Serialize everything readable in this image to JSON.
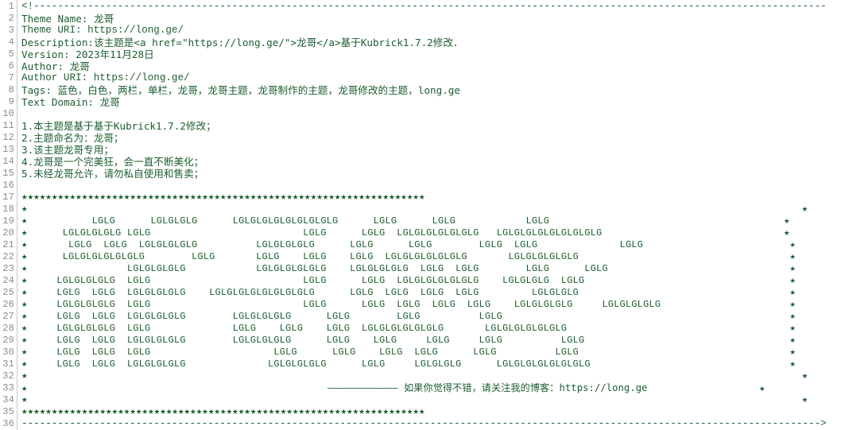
{
  "editor": {
    "language": "css-comment",
    "first_line": 1,
    "last_line": 36,
    "text_color": "#1c5e2e",
    "gutter_color": "#8c8c8c",
    "background": "#ffffff"
  },
  "gutter": {
    "line_numbers": [
      "1",
      "2",
      "3",
      "4",
      "5",
      "6",
      "7",
      "8",
      "9",
      "10",
      "11",
      "12",
      "13",
      "14",
      "15",
      "16",
      "17",
      "18",
      "19",
      "20",
      "21",
      "22",
      "23",
      "24",
      "25",
      "26",
      "27",
      "28",
      "29",
      "30",
      "31",
      "32",
      "33",
      "34",
      "35",
      "36"
    ]
  },
  "code": {
    "lines": [
      "<!------------------------------------------------------------------------------------------------------------------------------------",
      "Theme Name: 龙哥",
      "Theme URI: https://long.ge/",
      "Description:该主题是<a href=\"https://long.ge/\">龙哥</a>基于Kubrick1.7.2修改．",
      "Version: 2023年11月28日",
      "Author: 龙哥",
      "Author URI: https://long.ge/",
      "Tags: 蓝色，白色，两栏，单栏，龙哥，龙哥主题，龙哥制作的主题，龙哥修改的主题，long.ge",
      "Text Domain: 龙哥",
      "",
      "1.本主题是基于基于Kubrick1.7.2修改；",
      "2.主题命名为：龙哥；",
      "3.该主题龙哥专用；",
      "4.龙哥是一个完美狂，会一直不断美化；",
      "5.未经龙哥允许，请勿私自使用和售卖；",
      "",
      "★★★★★★★★★★★★★★★★★★★★★★★★★★★★★★★★★★★★★★★★★★★★★★★★★★★★★★★★★★★★★★★★★★★",
      "★                                                                                                                                 ★",
      "★           LGLG      LGLGLGLG      LGLGLGLGLGLGLGLGLG      LGLG      LGLG            LGLG                                        ★",
      "★      LGLGLGLGLG LGLG                          LGLG      LGLG  LGLGLGLGLGLGLG   LGLGLGLGLGLGLGLGLG                               ★",
      "★       LGLG  LGLG  LGLGLGLGLG          LGLGLGLGLG      LGLG      LGLG        LGLG  LGLG              LGLG                         ★",
      "★      LGLGLGLGLGLGLG        LGLG       LGLG    LGLG    LGLG  LGLGLGLGLGLGLG       LGLGLGLGLGLG                                    ★",
      "★                 LGLGLGLGLG            LGLGLGLGLGLG    LGLGLGLGLG  LGLG  LGLG        LGLG      LGLG                               ★",
      "★     LGLGLGLGLG  LGLG                          LGLG      LGLG  LGLGLGLGLGLGLG    LGLGLGLG  LGLG                                   ★",
      "★     LGLG  LGLG  LGLGLGLGLG    LGLGLGLGLGLGLGLGLG      LGLG  LGLG  LGLG  LGLG         LGLGLGLG                                    ★",
      "★     LGLGLGLGLG  LGLG                          LGLG      LGLG  LGLG  LGLG  LGLG    LGLGLGLGLG     LGLGLGLGLG                      ★",
      "★     LGLG  LGLG  LGLGLGLGLG        LGLGLGLGLG      LGLG        LGLG          LGLG                                                 ★",
      "★     LGLGLGLGLG  LGLG              LGLG    LGLG    LGLG  LGLGLGLGLGLGLG       LGLGLGLGLGLGLG                                      ★",
      "★     LGLG  LGLG  LGLGLGLGLG        LGLGLGLGLG      LGLG    LGLG     LGLG     LGLG          LGLG                                   ★",
      "★     LGLG  LGLG  LGLG                     LGLG      LGLG    LGLG  LGLG      LGLG          LGLG                                    ★",
      "★     LGLG  LGLG  LGLGLGLGLG              LGLGLGLGLG      LGLG     LGLGLGLG      LGLGLGLGLGLGLGLG                                  ★",
      "★                                                                                                                                 ★",
      "★                                                   ———————————— 如果你觉得不错，请关注我的博客：https://long.ge                   ★",
      "★                                                                                                                                 ★",
      "★★★★★★★★★★★★★★★★★★★★★★★★★★★★★★★★★★★★★★★★★★★★★★★★★★★★★★★★★★★★★★★★★★★",
      "------------------------------------------------------------------------------------------------------------------------------------->"
    ]
  },
  "art": {
    "glyph_token": "LGLG",
    "border_char": "★",
    "rows": [
      "                                                                                                                                 ",
      "           LGLG      LGLGLGLG      LGLGLGLGLGLGLGLGLG      LGLG      LGLG            LGLG                                        ",
      "      LGLGLGLGLG LGLG                          LGLG      LGLG  LGLGLGLGLGLGLG   LGLGLGLGLGLGLGLGLG                               ",
      "       LGLG  LGLG  LGLGLGLGLG          LGLGLGLGLG      LGLG      LGLG        LGLG  LGLG              LGLG                         ",
      "      LGLGLGLGLGLGLG        LGLG       LGLG    LGLG    LGLG  LGLGLGLGLGLGLG       LGLGLGLGLGLG                                    ",
      "                 LGLGLGLGLG            LGLGLGLGLGLG    LGLGLGLGLG  LGLG  LGLG        LGLG      LGLG                               ",
      "     LGLGLGLGLG  LGLG                          LGLG      LGLG  LGLGLGLGLGLGLG    LGLGLGLG  LGLG                                   ",
      "     LGLG  LGLG  LGLGLGLGLG    LGLGLGLGLGLGLGLGLG      LGLG  LGLG  LGLG  LGLG         LGLGLGLG                                    ",
      "     LGLGLGLGLG  LGLG                          LGLG      LGLG  LGLG  LGLG  LGLG    LGLGLGLGLG     LGLGLGLGLG                      ",
      "     LGLG  LGLG  LGLGLGLGLG        LGLGLGLGLG      LGLG        LGLG          LGLG                                                 ",
      "     LGLGLGLGLG  LGLG              LGLG    LGLG    LGLG  LGLGLGLGLGLGLG       LGLGLGLGLGLGLG                                      ",
      "     LGLG  LGLG  LGLGLGLGLG        LGLGLGLGLG      LGLG    LGLG     LGLG     LGLG          LGLG                                   ",
      "     LGLG  LGLG  LGLG                     LGLG      LGLG    LGLG  LGLG      LGLG          LGLG                                    ",
      "     LGLG  LGLG  LGLGLGLGLG              LGLGLGLGLG      LGLG     LGLGLGLG      LGLGLGLGLGLGLGLG                                  ",
      "                                                                                                                                 "
    ]
  },
  "footer_note": {
    "dashes": "————————————",
    "text": "如果你觉得不错，请关注我的博客：",
    "url": "https://long.ge"
  },
  "meta": {
    "theme_name": "龙哥",
    "theme_uri": "https://long.ge/",
    "description": "该主题是<a href=\"https://long.ge/\">龙哥</a>基于Kubrick1.7.2修改．",
    "version": "2023年11月28日",
    "author": "龙哥",
    "author_uri": "https://long.ge/",
    "tags": "蓝色，白色，两栏，单栏，龙哥，龙哥主题，龙哥制作的主题，龙哥修改的主题，long.ge",
    "text_domain": "龙哥"
  },
  "notes": [
    "1.本主题是基于基于Kubrick1.7.2修改；",
    "2.主题命名为：龙哥；",
    "3.该主题龙哥专用；",
    "4.龙哥是一个完美狂，会一直不断美化；",
    "5.未经龙哥允许，请勿私自使用和售卖；"
  ]
}
